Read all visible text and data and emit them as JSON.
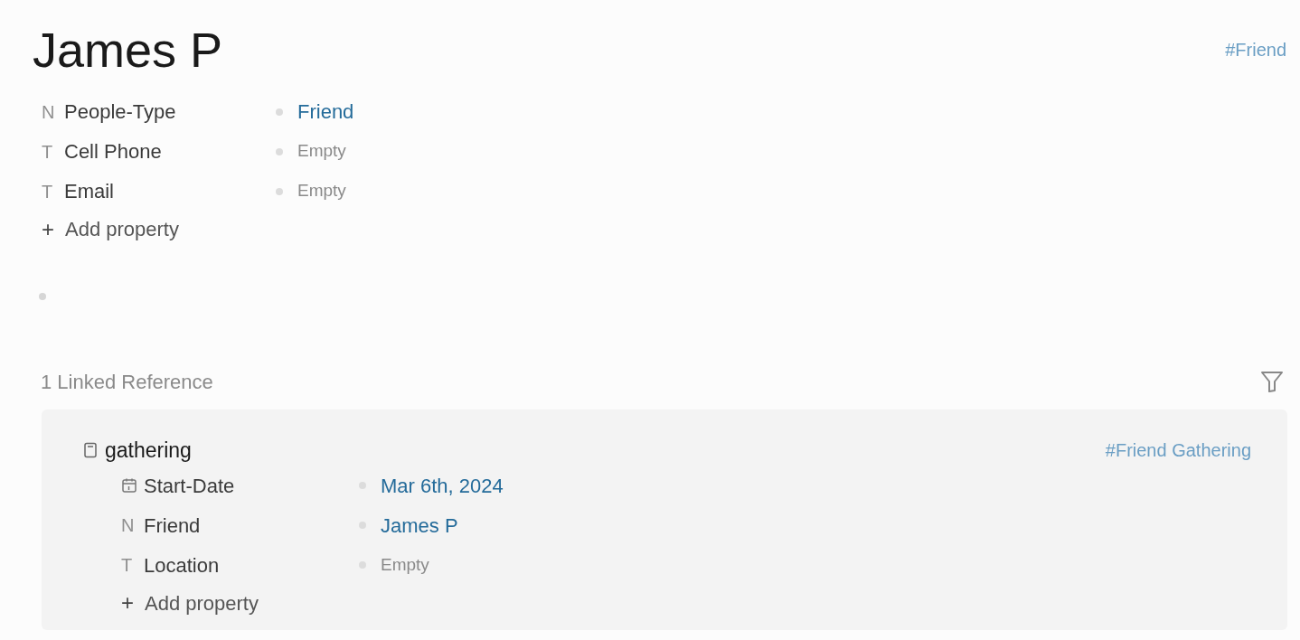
{
  "page": {
    "title": "James P",
    "tag": "#Friend"
  },
  "properties": [
    {
      "glyph": "N",
      "name": "People-Type",
      "value": "Friend",
      "kind": "link"
    },
    {
      "glyph": "T",
      "name": "Cell Phone",
      "value": "Empty",
      "kind": "empty"
    },
    {
      "glyph": "T",
      "name": "Email",
      "value": "Empty",
      "kind": "empty"
    }
  ],
  "add_property": {
    "glyph": "+",
    "label": "Add property"
  },
  "linked_references": {
    "heading": "1 Linked Reference",
    "items": [
      {
        "title": "gathering",
        "tag": "#Friend Gathering",
        "properties": [
          {
            "name": "Start-Date",
            "value": "Mar 6th, 2024",
            "kind": "link"
          },
          {
            "glyph": "N",
            "name": "Friend",
            "value": "James P",
            "kind": "link"
          },
          {
            "glyph": "T",
            "name": "Location",
            "value": "Empty",
            "kind": "empty"
          }
        ],
        "add_property": {
          "glyph": "+",
          "label": "Add property"
        }
      }
    ]
  }
}
